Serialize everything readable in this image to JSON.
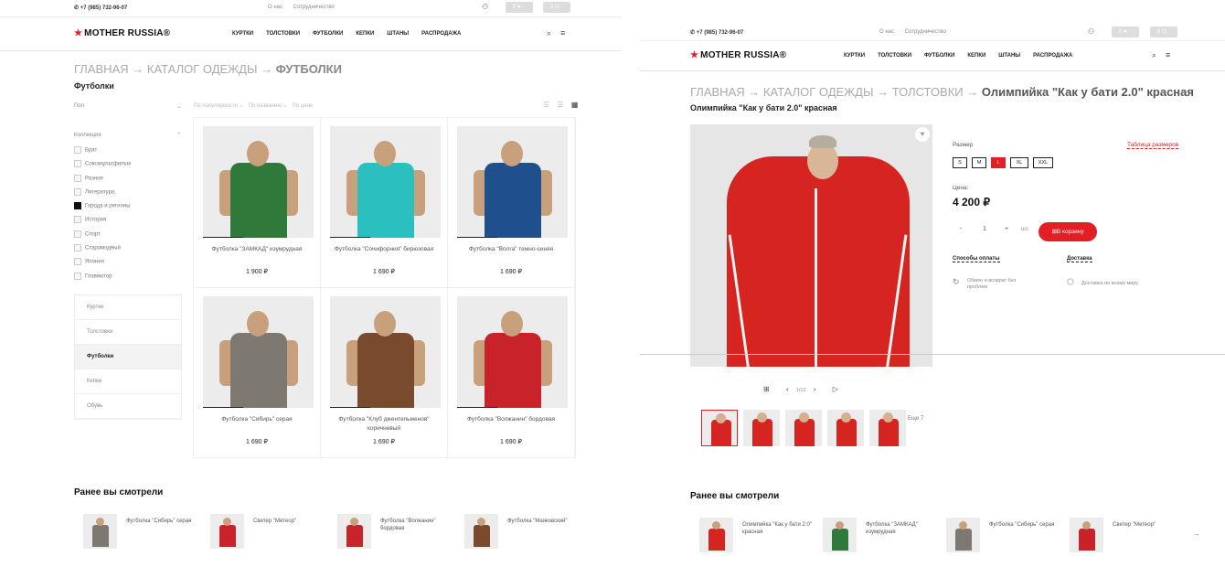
{
  "site": {
    "phone": "+7 (985) 732-96-07",
    "top_links": [
      "О нас",
      "Сотрудничество"
    ],
    "cart_count": "0",
    "fav_count": "0",
    "logo": "MOTHER RUSSIA®",
    "nav": [
      "КУРТКИ",
      "ТОЛСТОВКИ",
      "ФУТБОЛКИ",
      "КЕПКИ",
      "ШТАНЫ",
      "РАСПРОДАЖА"
    ]
  },
  "catalog": {
    "breadcrumb": [
      "ГЛАВНАЯ",
      "→",
      "КАТАЛОГ ОДЕЖДЫ",
      "→",
      "ФУТБОЛКИ"
    ],
    "title": "Футболки",
    "filter_gender": "Пол",
    "sort_options": [
      "По популярности",
      "По названию",
      "По цене"
    ],
    "collection_label": "Коллекция",
    "collections": [
      {
        "label": "Брат",
        "checked": false
      },
      {
        "label": "Союзмультфильм",
        "checked": false
      },
      {
        "label": "Разное",
        "checked": false
      },
      {
        "label": "Литература",
        "checked": false
      },
      {
        "label": "Города и регионы",
        "checked": true
      },
      {
        "label": "История",
        "checked": false
      },
      {
        "label": "Спорт",
        "checked": false
      },
      {
        "label": "Старомодный",
        "checked": false
      },
      {
        "label": "Япония",
        "checked": false
      },
      {
        "label": "Главмотор",
        "checked": false
      }
    ],
    "categories": [
      "Куртки",
      "Толстовки",
      "Футболки",
      "Кепки",
      "Обувь"
    ],
    "active_category": "Футболки",
    "products": [
      {
        "name": "Футболка \"ЗАМКАД\" изумрудная",
        "price": "1 900 ₽",
        "color": "#2f7a3a"
      },
      {
        "name": "Футболка \"Сочифорния\" бирюзовая",
        "price": "1 690 ₽",
        "color": "#2bbfc0"
      },
      {
        "name": "Футболка \"Волга\" темно-синяя",
        "price": "1 690 ₽",
        "color": "#1f4f8c"
      },
      {
        "name": "Футболка \"Сибирь\" серая",
        "price": "1 690 ₽",
        "color": "#7d7870"
      },
      {
        "name": "Футболка \"Клуб джентельменов\" коричневый",
        "price": "1 690 ₽",
        "color": "#7a4a2c"
      },
      {
        "name": "Футболка \"Волжанин\" бордовая",
        "price": "1 690 ₽",
        "color": "#c8222a"
      }
    ],
    "recent_title": "Ранее вы смотрели",
    "recent": [
      {
        "name": "Футболка \"Сибирь\" серая",
        "color": "#7d7870"
      },
      {
        "name": "Свитер \"Метеор\"",
        "color": "#c8222a"
      },
      {
        "name": "Футболка \"Волжанин\" бордовая",
        "color": "#c8222a"
      },
      {
        "name": "Футболка \"Маяковский\"",
        "color": "#7a4a2c"
      }
    ]
  },
  "product": {
    "breadcrumb": [
      "ГЛАВНАЯ",
      "→",
      "КАТАЛОГ ОДЕЖДЫ",
      "→",
      "ТОЛСТОВКИ",
      "→",
      "Олимпийка \"Как у бати 2.0\" красная"
    ],
    "title": "Олимпийка \"Как у бати 2.0\" красная",
    "size_label": "Размер",
    "size_table": "Таблица размеров",
    "sizes": [
      "S",
      "M",
      "L",
      "XL",
      "XXL"
    ],
    "selected_size": "L",
    "price_label": "Цена:",
    "price": "4 200 ₽",
    "qty": "1",
    "qty_minus": "-",
    "qty_plus": "+",
    "unit": "шт.",
    "cart_button": "В корзину",
    "payment_link": "Способы оплаты",
    "delivery_link": "Доставка",
    "exchange_note": "Обмен и возврат без проблем",
    "delivery_note": "Доставка по всему миру",
    "gallery_counter": "1/12",
    "more_thumbs": "Еще 7",
    "recent_title": "Ранее вы смотрели",
    "recent": [
      {
        "name": "Олимпийка \"Как у бати 2.0\" красная",
        "color": "#d62420"
      },
      {
        "name": "Футболка \"ЗАМКАД\" изумрудная",
        "color": "#2f7a3a"
      },
      {
        "name": "Футболка \"Сибирь\" серая",
        "color": "#7d7870"
      },
      {
        "name": "Свитер \"Метеор\"",
        "color": "#c8222a"
      }
    ]
  },
  "colors": {
    "accent": "#e31e24"
  }
}
